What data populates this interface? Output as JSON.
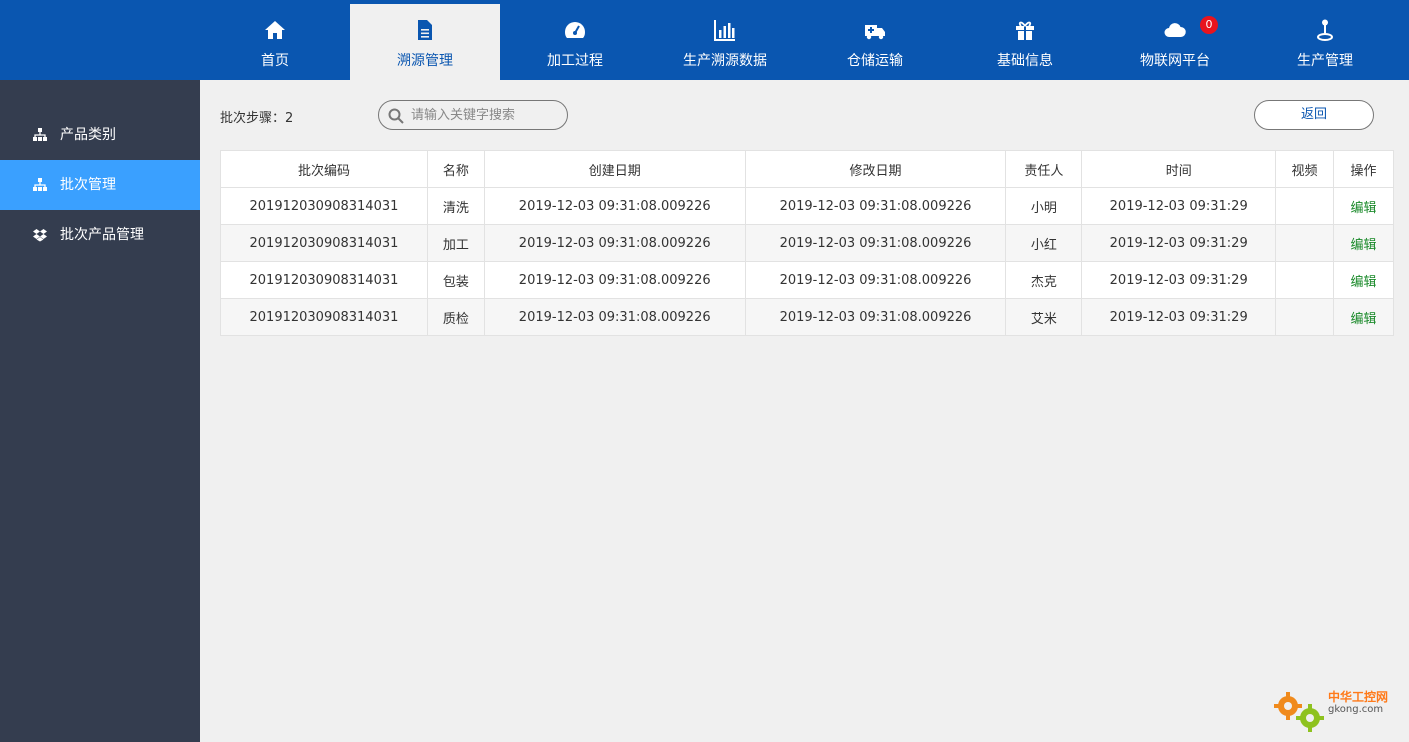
{
  "nav": {
    "items": [
      {
        "label": "首页",
        "icon": "home-icon"
      },
      {
        "label": "溯源管理",
        "icon": "document-icon"
      },
      {
        "label": "加工过程",
        "icon": "dashboard-icon"
      },
      {
        "label": "生产溯源数据",
        "icon": "bar-chart-icon"
      },
      {
        "label": "仓储运输",
        "icon": "ambulance-icon"
      },
      {
        "label": "基础信息",
        "icon": "gift-icon"
      },
      {
        "label": "物联网平台",
        "icon": "cloud-icon",
        "badge": "0"
      },
      {
        "label": "生产管理",
        "icon": "joystick-icon"
      }
    ],
    "active_index": 1
  },
  "sidebar": {
    "items": [
      {
        "label": "产品类别",
        "icon": "sitemap-icon"
      },
      {
        "label": "批次管理",
        "icon": "sitemap-icon"
      },
      {
        "label": "批次产品管理",
        "icon": "dropbox-icon"
      }
    ],
    "active_index": 1
  },
  "toolbar": {
    "step_label": "批次步骤：2",
    "search_placeholder": "请输入关键字搜索",
    "back_label": "返回"
  },
  "table": {
    "headers": [
      "批次编码",
      "名称",
      "创建日期",
      "修改日期",
      "责任人",
      "时间",
      "视频",
      "操作"
    ],
    "rows": [
      [
        "201912030908314031",
        "清洗",
        "2019-12-03 09:31:08.009226",
        "2019-12-03 09:31:08.009226",
        "小明",
        "2019-12-03 09:31:29",
        "",
        "编辑"
      ],
      [
        "201912030908314031",
        "加工",
        "2019-12-03 09:31:08.009226",
        "2019-12-03 09:31:08.009226",
        "小红",
        "2019-12-03 09:31:29",
        "",
        "编辑"
      ],
      [
        "201912030908314031",
        "包装",
        "2019-12-03 09:31:08.009226",
        "2019-12-03 09:31:08.009226",
        "杰克",
        "2019-12-03 09:31:29",
        "",
        "编辑"
      ],
      [
        "201912030908314031",
        "质检",
        "2019-12-03 09:31:08.009226",
        "2019-12-03 09:31:08.009226",
        "艾米",
        "2019-12-03 09:31:29",
        "",
        "编辑"
      ]
    ]
  },
  "watermark": {
    "line1": "中华工控网",
    "line2": "gkong.com"
  },
  "colors": {
    "topbar": "#0a56b0",
    "sidebar": "#343d4f",
    "sidebar_active": "#3aa0ff",
    "badge": "#e8141e",
    "edit_link": "#1a8a2a"
  }
}
